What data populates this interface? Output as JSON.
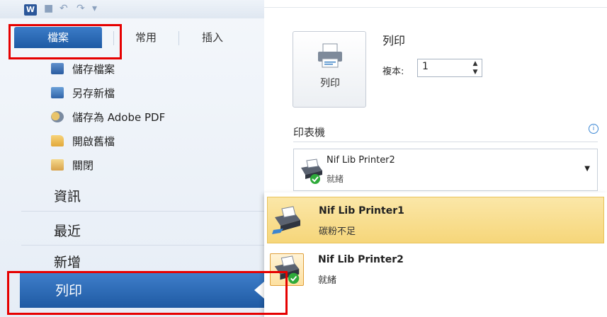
{
  "qat": {
    "app_icon": "word-icon",
    "app_letter": "W",
    "icons": [
      "save-icon",
      "undo-icon",
      "redo-icon",
      "customize-icon"
    ]
  },
  "tabs": {
    "file": "檔案",
    "home": "常用",
    "insert": "插入"
  },
  "file_menu": {
    "items": [
      {
        "label": "儲存檔案",
        "icon": "save-icon"
      },
      {
        "label": "另存新檔",
        "icon": "save-as-icon"
      },
      {
        "label": "儲存為 Adobe PDF",
        "icon": "pdf-icon"
      },
      {
        "label": "開啟舊檔",
        "icon": "open-folder-icon"
      },
      {
        "label": "關閉",
        "icon": "close-folder-icon"
      }
    ],
    "nav": [
      "資訊",
      "最近",
      "新增"
    ],
    "print": "列印"
  },
  "print_panel": {
    "button_label": "列印",
    "title": "列印",
    "copies_label": "複本:",
    "copies_value": "1",
    "printer_section_title": "印表機",
    "selected_printer": {
      "name": "Nif Lib Printer2",
      "status": "就緒"
    },
    "printers": [
      {
        "name": "Nif Lib Printer1",
        "status": "碳粉不足",
        "highlighted": true
      },
      {
        "name": "Nif Lib Printer2",
        "status": "就緒",
        "highlighted": false
      }
    ]
  },
  "colors": {
    "accent": "#1f5aa3",
    "highlight": "#f6d67a",
    "annotation": "#e60000"
  }
}
